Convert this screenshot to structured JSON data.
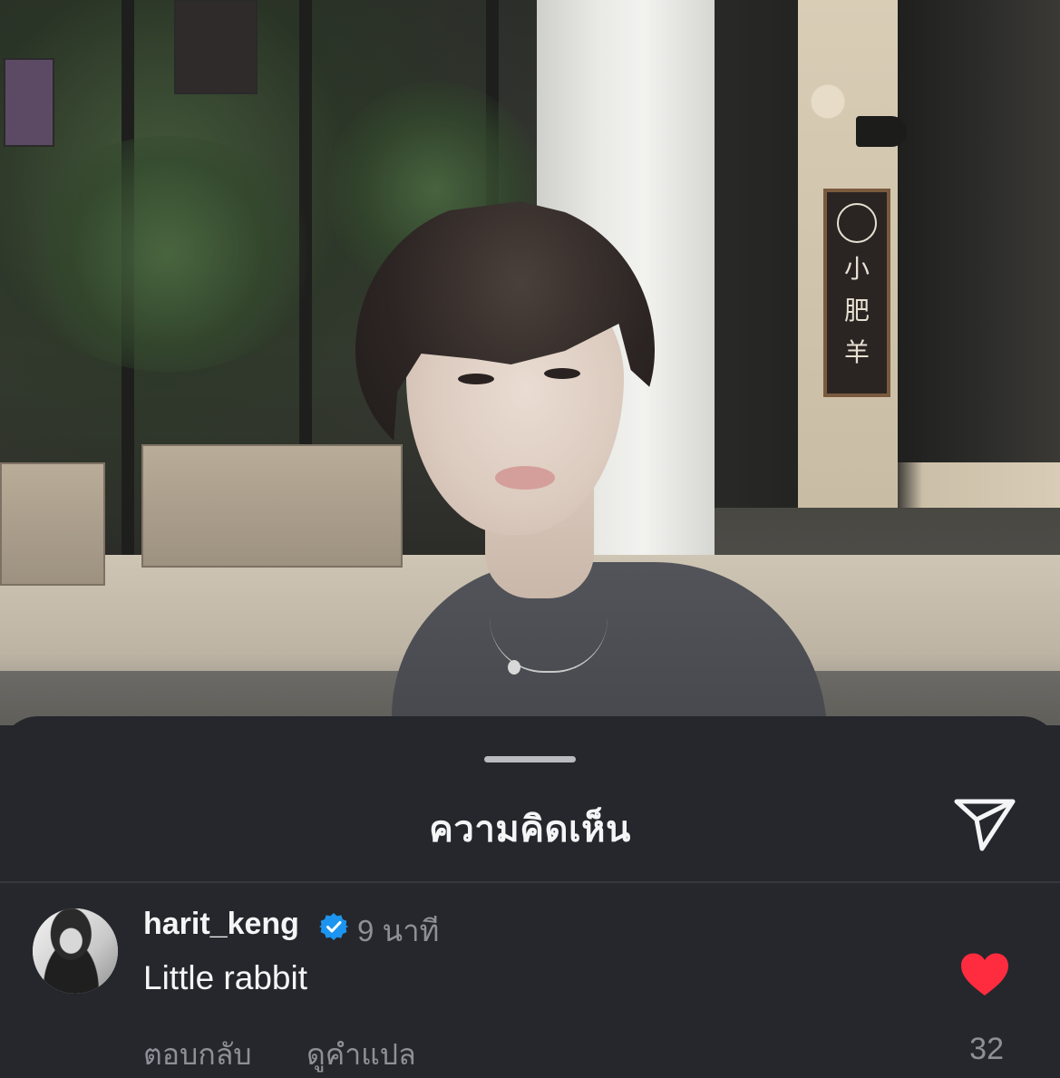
{
  "sheet": {
    "title": "ความคิดเห็น"
  },
  "comment": {
    "username": "harit_keng",
    "verified": true,
    "time": "9 นาที",
    "text": "Little rabbit",
    "liked": true,
    "like_count": "32",
    "reply_label": "ตอบกลับ",
    "translate_label": "ดูคำแปล"
  },
  "sign": {
    "chars": [
      "小",
      "肥",
      "羊"
    ]
  },
  "icons": {
    "share": "send-icon",
    "heart": "heart-filled-icon",
    "verified": "verified-badge-icon"
  },
  "colors": {
    "sheet_bg": "#25272c",
    "text_primary": "#f5f5f7",
    "text_secondary": "#8e9097",
    "heart": "#ff2b3f",
    "verified": "#1c95f0"
  }
}
